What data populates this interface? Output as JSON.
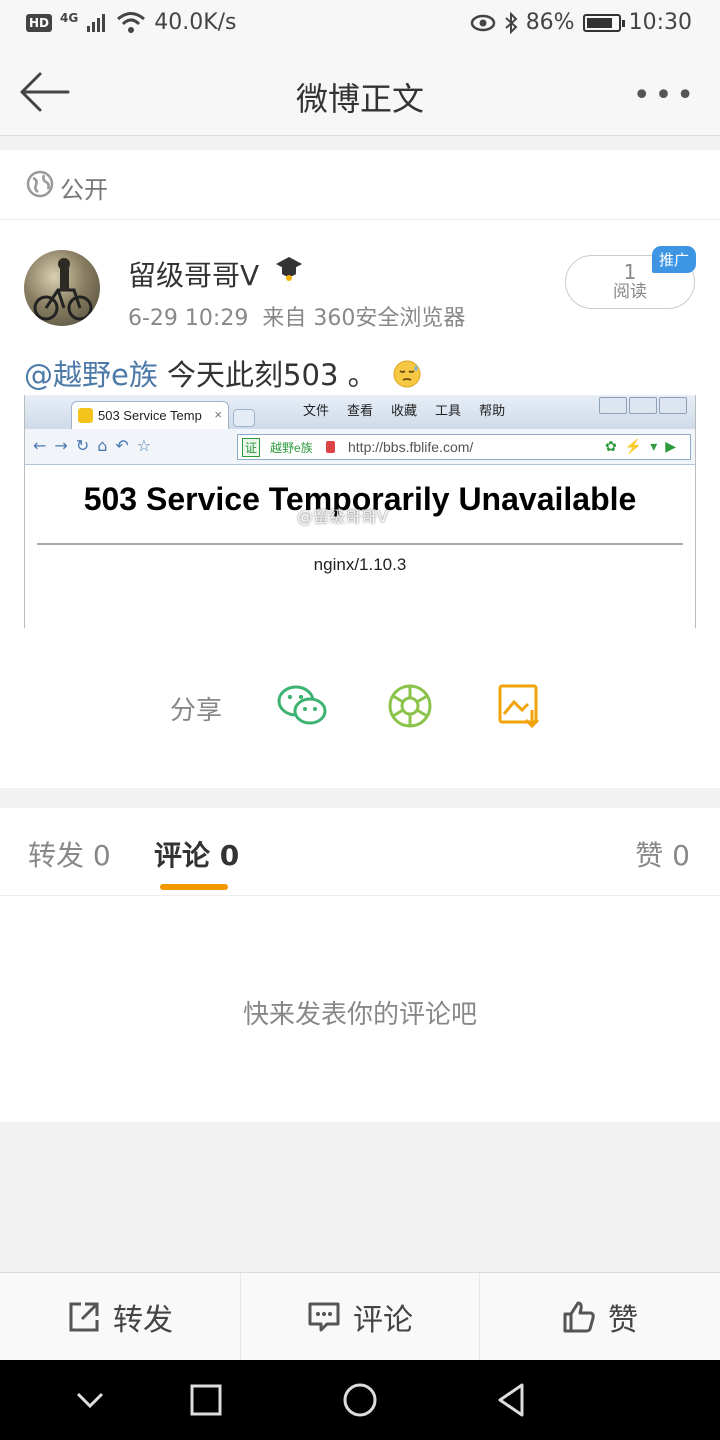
{
  "status_bar": {
    "hd": "HD",
    "network": "4G",
    "speed": "40.0K/s",
    "battery_percent": "86%",
    "battery_level": 0.86,
    "time": "10:30"
  },
  "nav": {
    "title": "微博正文",
    "more": "•••"
  },
  "visibility": {
    "label": "公开"
  },
  "post": {
    "author": "留级哥哥V",
    "time": "6-29 10:29",
    "source": "来自 360安全浏览器",
    "read_count": "1",
    "read_label": "阅读",
    "promo": "推广",
    "mention": "@越野e族",
    "text": " 今天此刻503 。",
    "image": {
      "tab_title": "503 Service Temp",
      "tab_close": "×",
      "menu": [
        "文件",
        "查看",
        "收藏",
        "工具",
        "帮助"
      ],
      "cert": "证",
      "site_name": "越野e族",
      "url": "http://bbs.fblife.com/",
      "error_title": "503 Service Temporarily Unavailable",
      "server": "nginx/1.10.3",
      "watermark": "@留级哥哥V"
    }
  },
  "share": {
    "label": "分享"
  },
  "tabs": {
    "repost": "转发 0",
    "comments": "评论 0",
    "likes": "赞 0"
  },
  "comments": {
    "empty": "快来发表你的评论吧"
  },
  "actions": {
    "repost": "转发",
    "comment": "评论",
    "like": "赞"
  },
  "colors": {
    "accent": "#f39800",
    "link": "#4d7aa8",
    "wechat": "#3cb371",
    "moments": "#8bc34a",
    "save": "#f0a30a",
    "promo": "#3d95e3"
  }
}
